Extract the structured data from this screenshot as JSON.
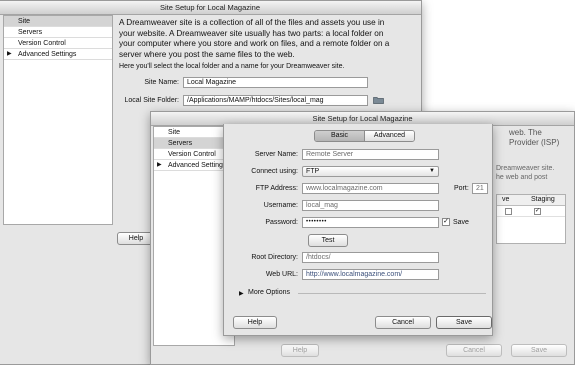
{
  "back_window": {
    "title": "Site Setup for Local Magazine",
    "sidebar": [
      {
        "label": "Site",
        "arrow": ""
      },
      {
        "label": "Servers",
        "arrow": ""
      },
      {
        "label": "Version Control",
        "arrow": ""
      },
      {
        "label": "Advanced Settings",
        "arrow": "▶"
      }
    ],
    "intro_lines": [
      "A Dreamweaver site is a collection of all of the files and assets you use in",
      "your website. A Dreamweaver site usually has two parts: a local folder on",
      "your computer where you store and work on files, and a remote folder on a",
      "server where you post the same files to the web."
    ],
    "select_text": "Here you'll select the local folder and a name for your Dreamweaver site.",
    "site_name_label": "Site Name:",
    "site_name_value": "Local Magazine",
    "local_folder_label": "Local Site Folder:",
    "local_folder_value": "/Applications/MAMP/htdocs/Sites/local_mag",
    "help_label": "Help"
  },
  "middle_window": {
    "title": "Site Setup for Local Magazine",
    "sidebar": [
      {
        "label": "Site",
        "arrow": ""
      },
      {
        "label": "Servers",
        "arrow": ""
      },
      {
        "label": "Version Control",
        "arrow": ""
      },
      {
        "label": "Advanced Settings",
        "arrow": "▶"
      }
    ],
    "right_text_lines": [
      "web. The",
      "Provider (ISP)"
    ],
    "right_text_lines2": [
      "Dreamweaver site.",
      "he web and post"
    ],
    "table_headers": [
      "ve",
      "Staging"
    ],
    "help_label": "Help",
    "cancel_label": "Cancel",
    "save_label": "Save"
  },
  "server_dialog": {
    "tabs": {
      "basic": "Basic",
      "advanced": "Advanced"
    },
    "server_name_label": "Server Name:",
    "server_name_value": "Remote Server",
    "connect_using_label": "Connect using:",
    "connect_using_value": "FTP",
    "ftp_address_label": "FTP Address:",
    "ftp_address_value": "www.localmagazine.com",
    "port_label": "Port:",
    "port_value": "21",
    "username_label": "Username:",
    "username_value": "local_mag",
    "password_label": "Password:",
    "password_value": "••••••••",
    "save_checkbox_label": "Save",
    "test_label": "Test",
    "root_dir_label": "Root Directory:",
    "root_dir_value": "/htdocs/",
    "web_url_label": "Web URL:",
    "web_url_value": "http://www.localmagazine.com/",
    "more_options_label": "More Options",
    "more_options_arrow": "▶",
    "help_label": "Help",
    "cancel_label": "Cancel",
    "save_label": "Save"
  }
}
